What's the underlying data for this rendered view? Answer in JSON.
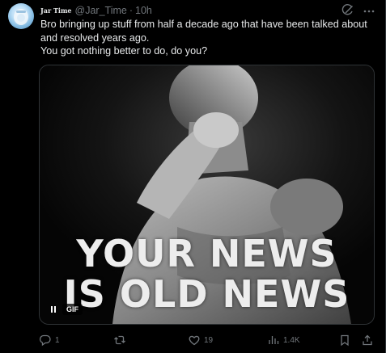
{
  "tweet": {
    "display_name": "Jar Time",
    "handle": "@Jar_Time",
    "separator": "·",
    "time": "10h",
    "text_lines": [
      "Bro bringing up stuff from half a decade ago that have been talked about",
      "and resolved years ago.",
      "You got nothing better to do, do you?"
    ],
    "media": {
      "caption_line1": "YOUR NEWS",
      "caption_line2": "IS OLD NEWS",
      "badge": "GIF"
    },
    "actions": {
      "replies": "1",
      "retweets": "",
      "likes": "19",
      "views": "1.4K"
    },
    "icons": {
      "grok": "grok-icon",
      "more": "more-icon",
      "reply": "reply-icon",
      "retweet": "retweet-icon",
      "like": "heart-icon",
      "views": "views-icon",
      "bookmark": "bookmark-icon",
      "share": "share-icon",
      "pause": "pause-icon"
    },
    "colors": {
      "background": "#000000",
      "text": "#e7e9ea",
      "muted": "#71767b",
      "border": "#2f3336"
    }
  }
}
